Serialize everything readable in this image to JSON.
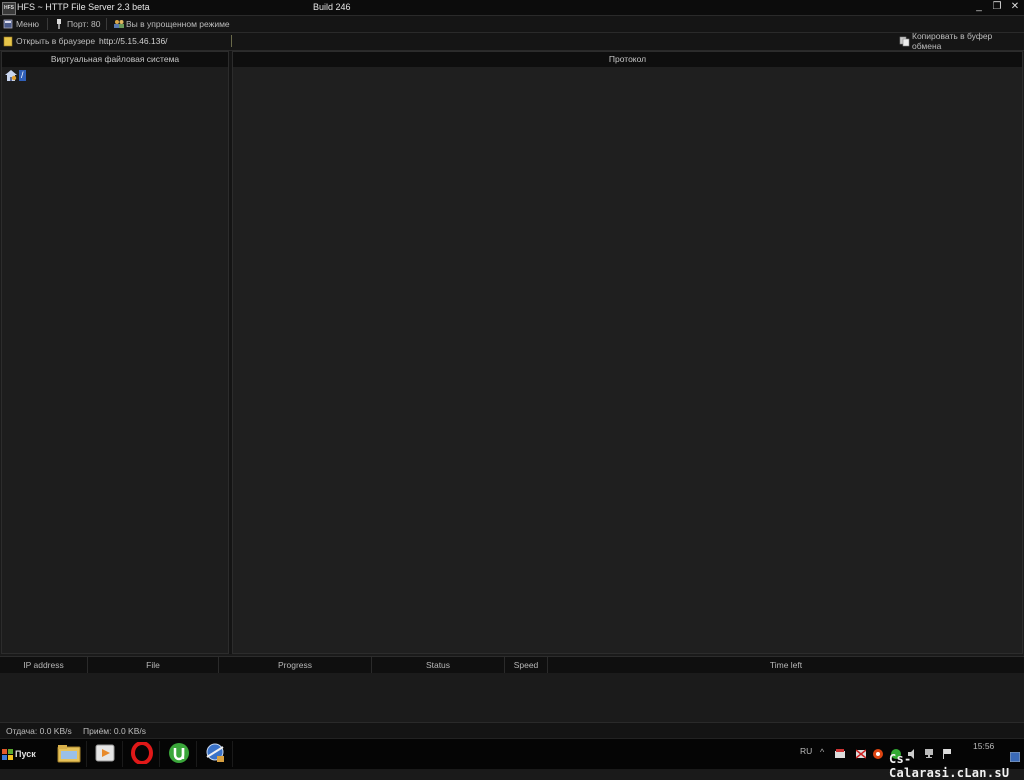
{
  "window": {
    "app_icon_text": "HFS",
    "title": "HFS ~ HTTP File Server 2.3 beta",
    "build": "Build 246",
    "minimize_glyph": "_",
    "restore_glyph": "❐",
    "close_glyph": "✕"
  },
  "toolbar": {
    "menu_label": "Меню",
    "port_label": "Порт: 80",
    "mode_label": "Вы в упрощенном режиме"
  },
  "urlbar": {
    "open_browser_label": "Открыть в браузере",
    "url_value": "http://5.15.46.136/",
    "copy_label": "Копировать в буфер обмена"
  },
  "vfs": {
    "header": "Виртуальная файловая система",
    "root_label": "/"
  },
  "log": {
    "header": "Протокол"
  },
  "transfers": {
    "columns": [
      "IP address",
      "File",
      "Progress",
      "Status",
      "Speed",
      "Time left"
    ]
  },
  "status": {
    "upload": "Отдача: 0.0 KB/s",
    "download": "Приём: 0.0 KB/s"
  },
  "taskbar": {
    "start_label": "Пуск",
    "language": "RU",
    "clock": "15:56",
    "watermark": "Cs-Calarasi.cLan.sU",
    "quick_launch_icons": [
      "explorer-icon",
      "media-player-icon",
      "opera-icon",
      "utorrent-icon",
      "hfs-icon"
    ]
  },
  "colors": {
    "background": "#1a1a1a",
    "panel": "#1f1f1f",
    "selection": "#2f5fb8",
    "text": "#c8c8c8"
  }
}
